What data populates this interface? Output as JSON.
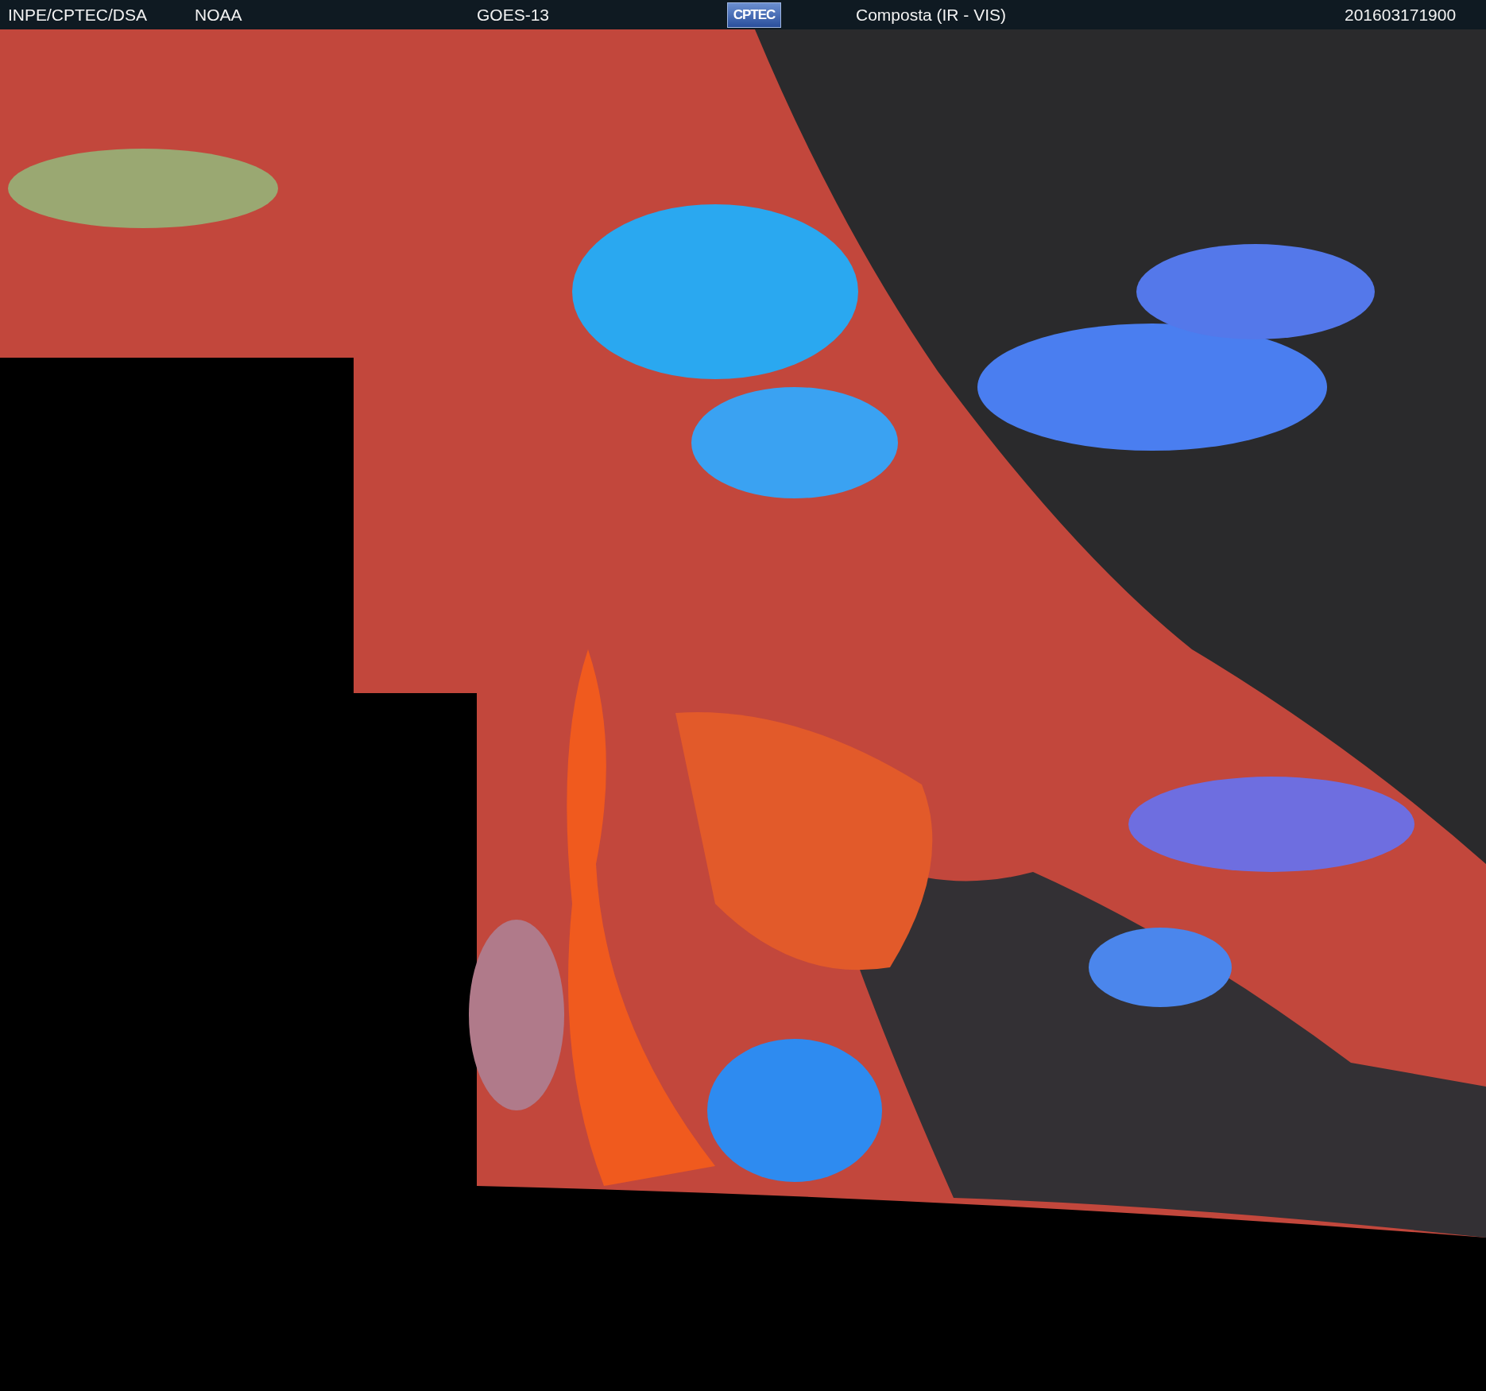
{
  "header": {
    "left": [
      "INPE/CPTEC/DSA",
      "NOAA"
    ],
    "satellite": "GOES-13",
    "logo": "CPTEC",
    "product": "Composta (IR - VIS)",
    "timestamp": "201603171900"
  }
}
